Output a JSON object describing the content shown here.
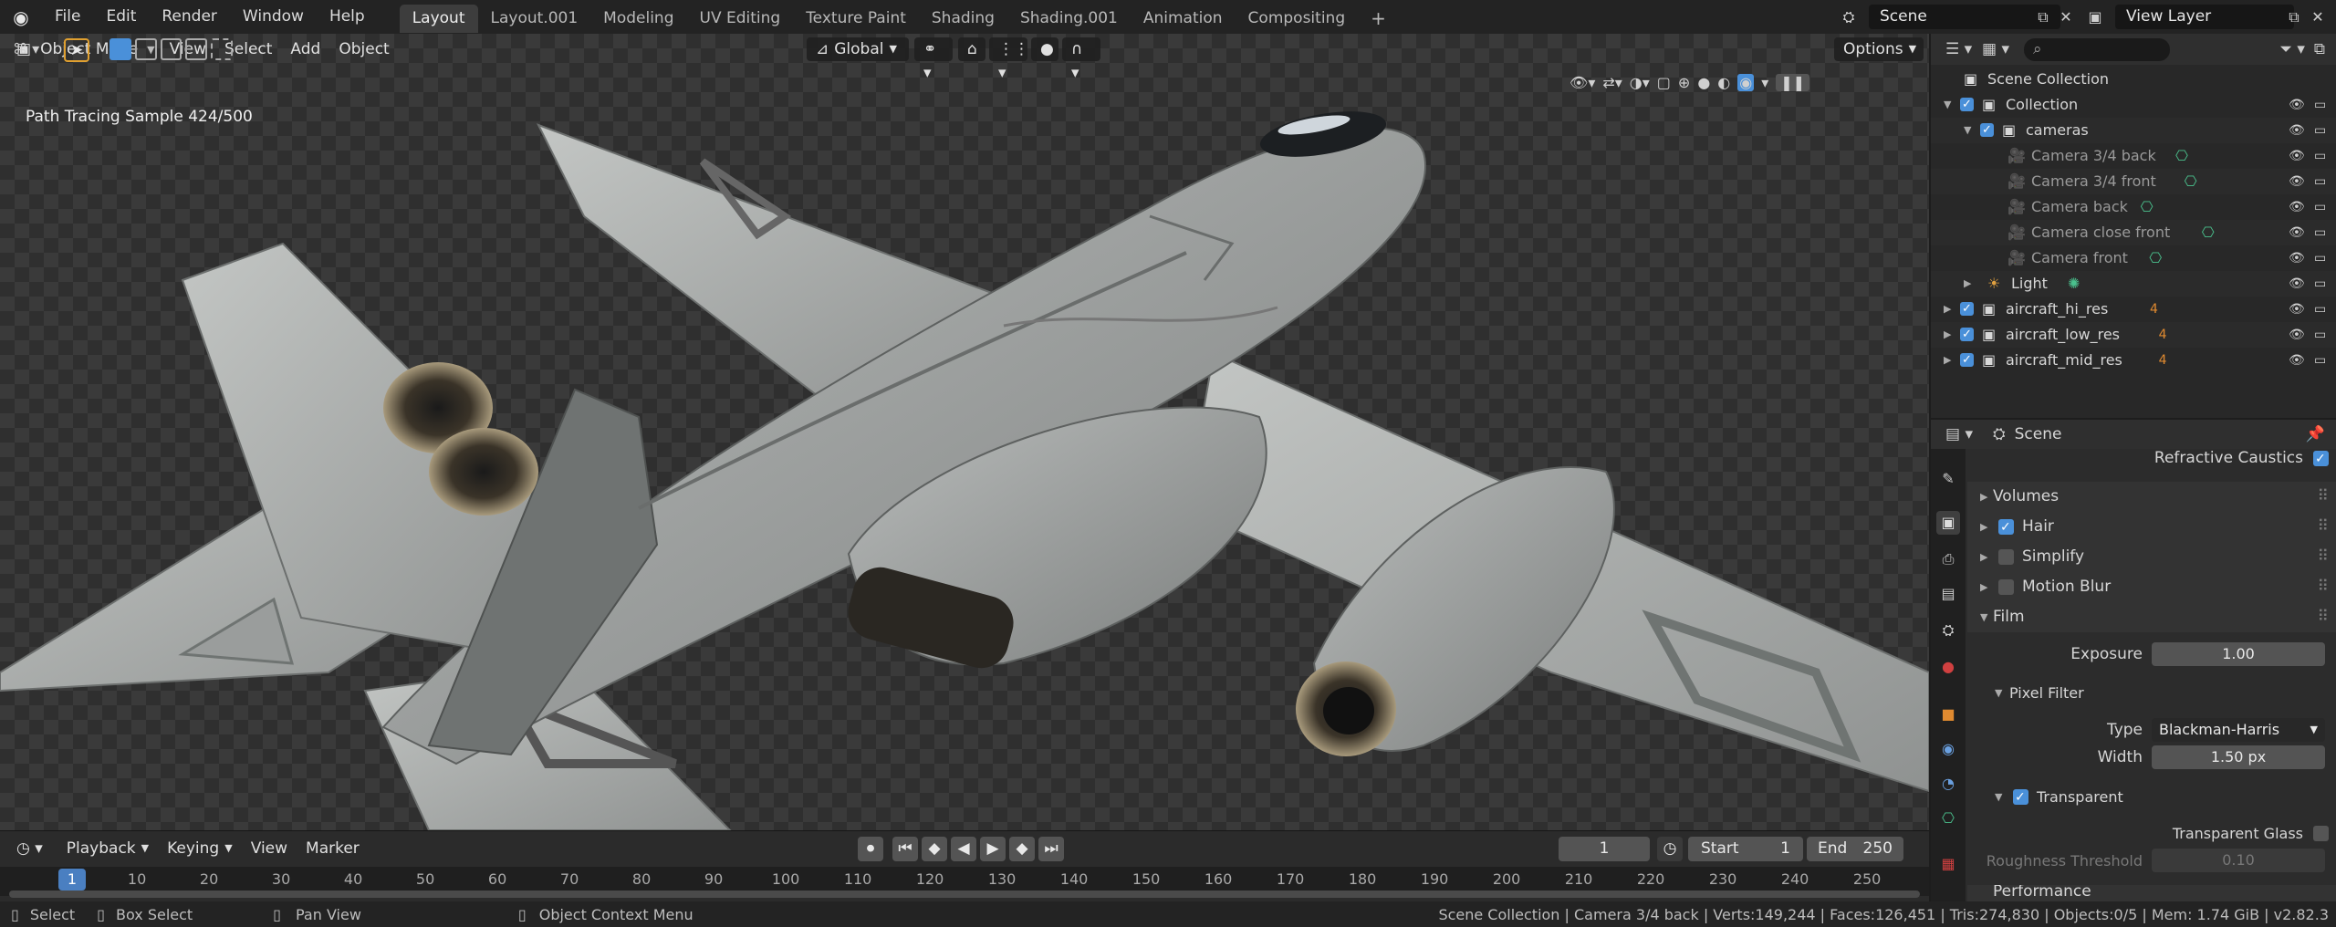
{
  "menu": [
    "File",
    "Edit",
    "Render",
    "Window",
    "Help"
  ],
  "workspace_tabs": [
    "Layout",
    "Layout.001",
    "Modeling",
    "UV Editing",
    "Texture Paint",
    "Shading",
    "Shading.001",
    "Animation",
    "Compositing"
  ],
  "scene_name": "Scene",
  "view_layer": "View Layer",
  "viewport": {
    "mode": "Object Mode",
    "menus": [
      "View",
      "Select",
      "Add",
      "Object"
    ],
    "orientation": "Global",
    "options_label": "Options",
    "sample_text": "Path Tracing Sample 424/500"
  },
  "timeline": {
    "menus": [
      "Playback",
      "Keying",
      "View",
      "Marker"
    ],
    "current_frame": "1",
    "start_label": "Start",
    "start_value": "1",
    "end_label": "End",
    "end_value": "250",
    "ruler": [
      "1",
      "10",
      "20",
      "30",
      "40",
      "50",
      "60",
      "70",
      "80",
      "90",
      "100",
      "110",
      "120",
      "130",
      "140",
      "150",
      "160",
      "170",
      "180",
      "190",
      "200",
      "210",
      "220",
      "230",
      "240",
      "250"
    ]
  },
  "status": {
    "select": "Select",
    "box_select": "Box Select",
    "pan_view": "Pan View",
    "context_menu": "Object Context Menu",
    "info": "Scene Collection | Camera 3/4 back | Verts:149,244 | Faces:126,451 | Tris:274,830 | Objects:0/5 | Mem: 1.74 GiB | v2.82.3"
  },
  "outliner": {
    "root": "Scene Collection",
    "rows": [
      {
        "label": "Collection",
        "icon": "collection"
      },
      {
        "label": "cameras",
        "icon": "collection"
      },
      {
        "label": "Camera 3/4 back",
        "icon": "camera"
      },
      {
        "label": "Camera 3/4 front",
        "icon": "camera"
      },
      {
        "label": "Camera back",
        "icon": "camera"
      },
      {
        "label": "Camera close front",
        "icon": "camera"
      },
      {
        "label": "Camera front",
        "icon": "camera"
      },
      {
        "label": "Light",
        "icon": "light"
      },
      {
        "label": "aircraft_hi_res",
        "icon": "collection",
        "badge": "4"
      },
      {
        "label": "aircraft_low_res",
        "icon": "collection",
        "badge": "4"
      },
      {
        "label": "aircraft_mid_res",
        "icon": "collection",
        "badge": "4"
      }
    ]
  },
  "properties": {
    "context": "Scene",
    "refractive_caustics": "Refractive Caustics",
    "volumes": "Volumes",
    "hair": "Hair",
    "simplify": "Simplify",
    "motion_blur": "Motion Blur",
    "film": "Film",
    "exposure_label": "Exposure",
    "exposure_value": "1.00",
    "pixel_filter": "Pixel Filter",
    "type_label": "Type",
    "type_value": "Blackman-Harris",
    "width_label": "Width",
    "width_value": "1.50 px",
    "transparent": "Transparent",
    "transparent_glass": "Transparent Glass",
    "roughness_label": "Roughness Threshold",
    "roughness_value": "0.10",
    "performance": "Performance"
  },
  "colors": {
    "accent": "#4a90d9",
    "camera_icon": "#e0a040",
    "collection_icon": "#d8d8d8",
    "data_icon": "#4ac18d"
  }
}
